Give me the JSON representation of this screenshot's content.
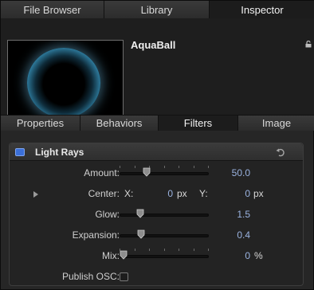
{
  "tabs_top": [
    {
      "label": "File Browser",
      "active": false
    },
    {
      "label": "Library",
      "active": false
    },
    {
      "label": "Inspector",
      "active": true
    }
  ],
  "asset": {
    "name": "AquaBall"
  },
  "tabs_sub": [
    {
      "label": "Properties",
      "active": false
    },
    {
      "label": "Behaviors",
      "active": false
    },
    {
      "label": "Filters",
      "active": true
    },
    {
      "label": "Image",
      "active": false
    }
  ],
  "filter": {
    "title": "Light Rays",
    "enabled": true,
    "amount": {
      "label": "Amount:",
      "value": "50.0",
      "fraction": 0.28
    },
    "center": {
      "label": "Center:",
      "x_label": "X:",
      "x_value": "0",
      "x_unit": "px",
      "y_label": "Y:",
      "y_value": "0",
      "y_unit": "px"
    },
    "glow": {
      "label": "Glow:",
      "value": "1.5",
      "fraction": 0.21
    },
    "expansion": {
      "label": "Expansion:",
      "value": "0.4",
      "fraction": 0.22
    },
    "mix": {
      "label": "Mix:",
      "value": "0",
      "unit": "%",
      "fraction": 0.0
    },
    "publish_osc": {
      "label": "Publish OSC:",
      "checked": false
    }
  },
  "colors": {
    "accent_blue": "#3b6fd8",
    "value_text": "#9ab3e0"
  }
}
